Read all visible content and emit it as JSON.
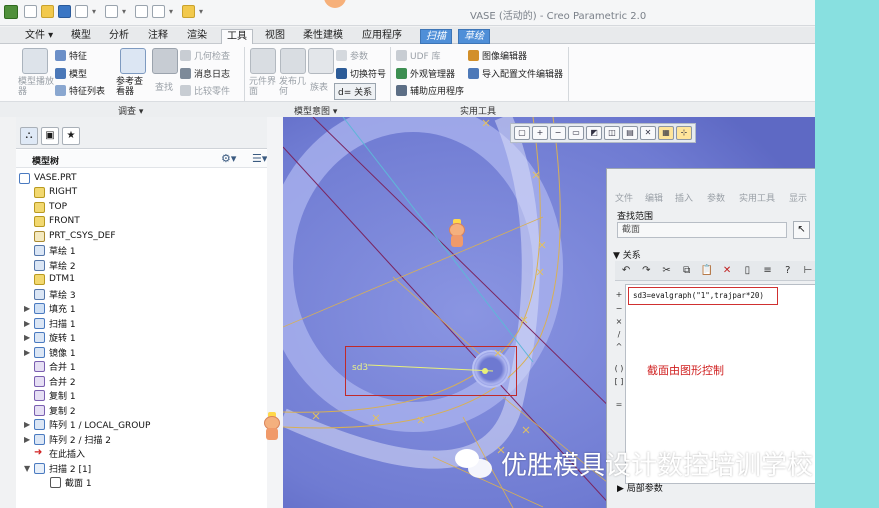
{
  "window": {
    "title": "VASE (活动的) - Creo Parametric 2.0"
  },
  "tabs": [
    {
      "label": "文件 ▾"
    },
    {
      "label": "模型"
    },
    {
      "label": "分析"
    },
    {
      "label": "注释"
    },
    {
      "label": "渲染"
    },
    {
      "label": "工具"
    },
    {
      "label": "视图"
    },
    {
      "label": "柔性建模"
    },
    {
      "label": "应用程序"
    },
    {
      "label": "扫描"
    },
    {
      "label": "草绘"
    }
  ],
  "ribbon": {
    "investigate": {
      "model_player": "模型播放器",
      "feature": "特征",
      "model": "模型",
      "feature_list": "特征列表",
      "ref_viewer": "参考查看器",
      "find": "查找",
      "geom_check": "几何检查",
      "message_log": "消息日志",
      "compare_parts": "比较零件"
    },
    "model_intent": {
      "components_ui": "元件界面",
      "publish_geom": "发布几何",
      "family_table": "族表",
      "params": "参数",
      "switch_symbols": "切换符号",
      "relations": "d= 关系"
    },
    "utilities": {
      "udf_lib": "UDF 库",
      "appearance_mgr": "外观管理器",
      "aux_apps": "辅助应用程序",
      "graph_editor": "图像编辑器",
      "import_config": "导入配置文件编辑器"
    },
    "groups": {
      "investigate": "调查 ▾",
      "model_intent": "模型意图 ▾",
      "utilities": "实用工具"
    }
  },
  "model_tree": {
    "header": "模型树",
    "items": [
      {
        "label": "VASE.PRT"
      },
      {
        "label": "RIGHT"
      },
      {
        "label": "TOP"
      },
      {
        "label": "FRONT"
      },
      {
        "label": "PRT_CSYS_DEF"
      },
      {
        "label": "草绘 1"
      },
      {
        "label": "草绘 2"
      },
      {
        "label": "DTM1"
      },
      {
        "label": "草绘 3"
      },
      {
        "label": "填充 1"
      },
      {
        "label": "扫描 1"
      },
      {
        "label": "旋转 1"
      },
      {
        "label": "镜像 1"
      },
      {
        "label": "合并 1"
      },
      {
        "label": "合并 2"
      },
      {
        "label": "复制 1"
      },
      {
        "label": "复制 2"
      },
      {
        "label": "阵列 1 / LOCAL_GROUP"
      },
      {
        "label": "阵列 2 / 扫描 2"
      },
      {
        "label": "在此插入"
      },
      {
        "label": "扫描 2 [1]"
      },
      {
        "label": "截面 1"
      }
    ]
  },
  "graphics": {
    "dimension_label": "sd3"
  },
  "relations_dialog": {
    "menu": [
      "文件",
      "编辑",
      "插入",
      "参数",
      "实用工具",
      "显示"
    ],
    "lookup_label": "查找范围",
    "lookup_value": "截面",
    "relations_label": "关系",
    "code": "sd3=evalgraph(\"1\",trajpar*20)",
    "note": "截面由图形控制",
    "local_params": "局部参数"
  },
  "watermark": "优胜模具设计数控培训学校"
}
